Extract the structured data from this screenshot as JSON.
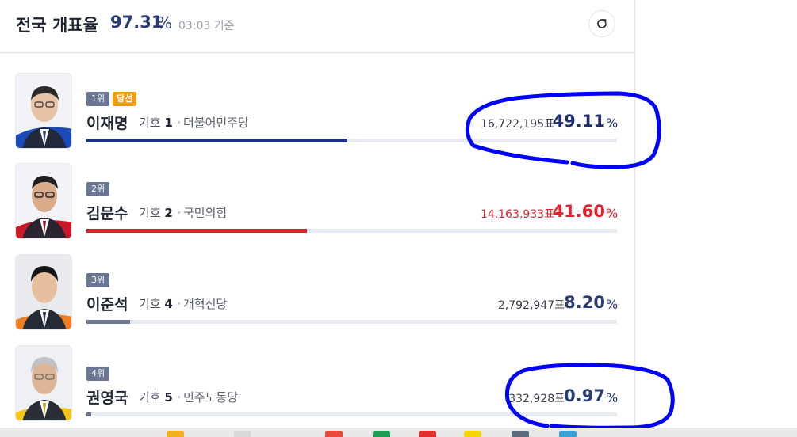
{
  "header": {
    "title": "전국 개표율",
    "rate": "97.31",
    "percent_sign": "%",
    "time": "03:03 기준"
  },
  "candidates": [
    {
      "rank": "1위",
      "winner_badge": "당선",
      "name": "이재명",
      "number_label": "기호",
      "number": "1",
      "party": "더불어민주당",
      "votes": "16,722,195표",
      "percent": "49.11",
      "percent_sign": "%",
      "share": 49.11,
      "color": "#1e2f86",
      "pct_color": "#1f2f6e"
    },
    {
      "rank": "2위",
      "name": "김문수",
      "number_label": "기호",
      "number": "2",
      "party": "국민의힘",
      "votes": "14,163,933표",
      "percent": "41.60",
      "percent_sign": "%",
      "share": 41.6,
      "color": "#e0222f",
      "pct_color": "#e0222f"
    },
    {
      "rank": "3위",
      "name": "이준석",
      "number_label": "기호",
      "number": "4",
      "party": "개혁신당",
      "votes": "2,792,947표",
      "percent": "8.20",
      "percent_sign": "%",
      "share": 8.2,
      "color": "#6b7594",
      "pct_color": "#2b3c73"
    },
    {
      "rank": "4위",
      "name": "권영국",
      "number_label": "기호",
      "number": "5",
      "party": "민주노동당",
      "votes": "332,928표",
      "percent": "0.97",
      "percent_sign": "%",
      "share": 0.97,
      "color": "#6b7594",
      "pct_color": "#2b3c73"
    }
  ],
  "annotation_color": "#0000ff",
  "icons": [
    "refresh-icon"
  ]
}
